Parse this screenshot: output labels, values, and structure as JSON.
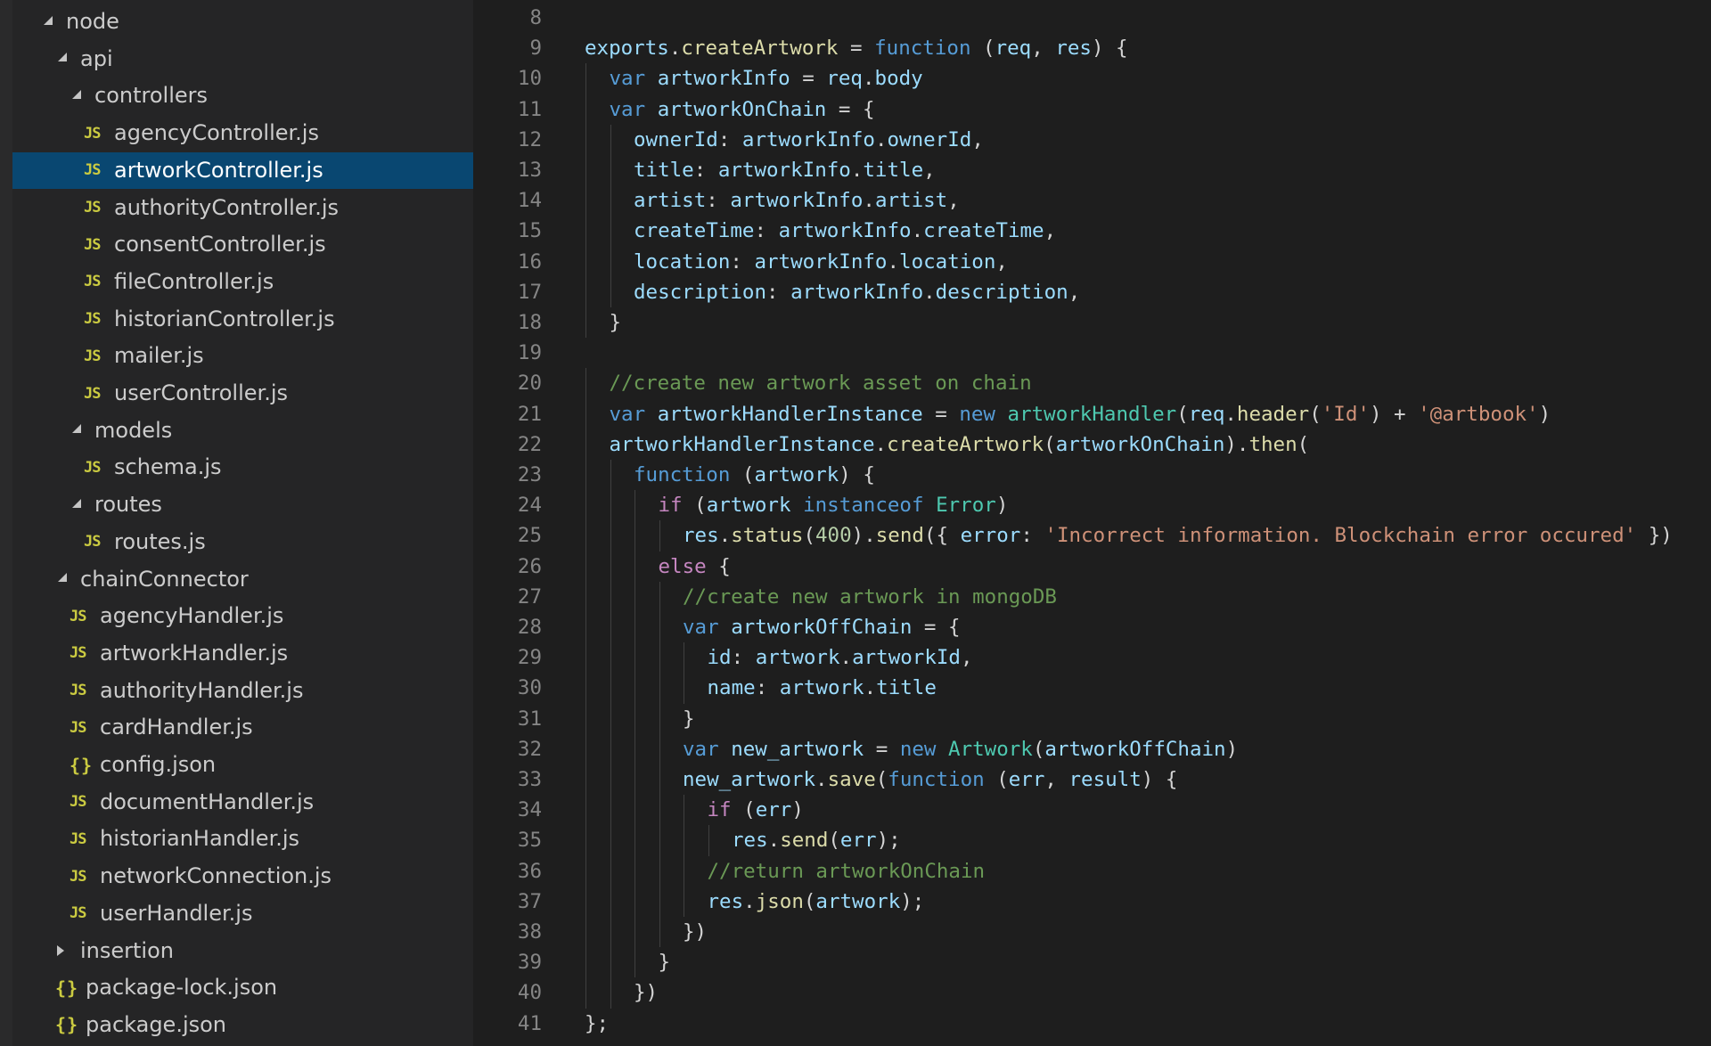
{
  "colors": {
    "sidebar_bg": "#252526",
    "editor_bg": "#1e1e1e",
    "selection": "#094771",
    "js_icon": "#cbcb41",
    "keyword": "#569cd6",
    "control": "#c586c0",
    "variable": "#9cdcfe",
    "function": "#dcdcaa",
    "string": "#ce9178",
    "number": "#b5cea8",
    "comment": "#6a9955",
    "class": "#4ec9b0"
  },
  "explorer": {
    "items": [
      {
        "label": "node",
        "type": "folder",
        "expanded": true,
        "depth": 0
      },
      {
        "label": "api",
        "type": "folder",
        "expanded": true,
        "depth": 1
      },
      {
        "label": "controllers",
        "type": "folder",
        "expanded": true,
        "depth": 2
      },
      {
        "label": "agencyController.js",
        "type": "js",
        "depth": 3
      },
      {
        "label": "artworkController.js",
        "type": "js",
        "depth": 3,
        "selected": true
      },
      {
        "label": "authorityController.js",
        "type": "js",
        "depth": 3
      },
      {
        "label": "consentController.js",
        "type": "js",
        "depth": 3
      },
      {
        "label": "fileController.js",
        "type": "js",
        "depth": 3
      },
      {
        "label": "historianController.js",
        "type": "js",
        "depth": 3
      },
      {
        "label": "mailer.js",
        "type": "js",
        "depth": 3
      },
      {
        "label": "userController.js",
        "type": "js",
        "depth": 3
      },
      {
        "label": "models",
        "type": "folder",
        "expanded": true,
        "depth": 2
      },
      {
        "label": "schema.js",
        "type": "js",
        "depth": 3
      },
      {
        "label": "routes",
        "type": "folder",
        "expanded": true,
        "depth": 2
      },
      {
        "label": "routes.js",
        "type": "js",
        "depth": 3
      },
      {
        "label": "chainConnector",
        "type": "folder",
        "expanded": true,
        "depth": 1
      },
      {
        "label": "agencyHandler.js",
        "type": "js",
        "depth": 2
      },
      {
        "label": "artworkHandler.js",
        "type": "js",
        "depth": 2
      },
      {
        "label": "authorityHandler.js",
        "type": "js",
        "depth": 2
      },
      {
        "label": "cardHandler.js",
        "type": "js",
        "depth": 2
      },
      {
        "label": "config.json",
        "type": "json",
        "depth": 2
      },
      {
        "label": "documentHandler.js",
        "type": "js",
        "depth": 2
      },
      {
        "label": "historianHandler.js",
        "type": "js",
        "depth": 2
      },
      {
        "label": "networkConnection.js",
        "type": "js",
        "depth": 2
      },
      {
        "label": "userHandler.js",
        "type": "js",
        "depth": 2
      },
      {
        "label": "insertion",
        "type": "folder",
        "expanded": false,
        "depth": 1
      },
      {
        "label": "package-lock.json",
        "type": "json",
        "depth": 1
      },
      {
        "label": "package.json",
        "type": "json",
        "depth": 1
      }
    ],
    "icons": {
      "js": "JS",
      "json": "{}"
    }
  },
  "editor": {
    "lines": [
      {
        "n": "8",
        "indent": 0,
        "tokens": []
      },
      {
        "n": "9",
        "indent": 0,
        "tokens": [
          [
            "var",
            "exports"
          ],
          [
            "punc",
            "."
          ],
          [
            "fn",
            "createArtwork"
          ],
          [
            "punc",
            " = "
          ],
          [
            "kw",
            "function"
          ],
          [
            "punc",
            " ("
          ],
          [
            "var",
            "req"
          ],
          [
            "punc",
            ", "
          ],
          [
            "var",
            "res"
          ],
          [
            "punc",
            ") {"
          ]
        ]
      },
      {
        "n": "10",
        "indent": 1,
        "tokens": [
          [
            "kw",
            "var"
          ],
          [
            "punc",
            " "
          ],
          [
            "var",
            "artworkInfo"
          ],
          [
            "punc",
            " = "
          ],
          [
            "var",
            "req"
          ],
          [
            "punc",
            "."
          ],
          [
            "var",
            "body"
          ]
        ]
      },
      {
        "n": "11",
        "indent": 1,
        "tokens": [
          [
            "kw",
            "var"
          ],
          [
            "punc",
            " "
          ],
          [
            "var",
            "artworkOnChain"
          ],
          [
            "punc",
            " = {"
          ]
        ]
      },
      {
        "n": "12",
        "indent": 2,
        "tokens": [
          [
            "var",
            "ownerId"
          ],
          [
            "punc",
            ": "
          ],
          [
            "var",
            "artworkInfo"
          ],
          [
            "punc",
            "."
          ],
          [
            "var",
            "ownerId"
          ],
          [
            "punc",
            ","
          ]
        ]
      },
      {
        "n": "13",
        "indent": 2,
        "tokens": [
          [
            "var",
            "title"
          ],
          [
            "punc",
            ": "
          ],
          [
            "var",
            "artworkInfo"
          ],
          [
            "punc",
            "."
          ],
          [
            "var",
            "title"
          ],
          [
            "punc",
            ","
          ]
        ]
      },
      {
        "n": "14",
        "indent": 2,
        "tokens": [
          [
            "var",
            "artist"
          ],
          [
            "punc",
            ": "
          ],
          [
            "var",
            "artworkInfo"
          ],
          [
            "punc",
            "."
          ],
          [
            "var",
            "artist"
          ],
          [
            "punc",
            ","
          ]
        ]
      },
      {
        "n": "15",
        "indent": 2,
        "tokens": [
          [
            "var",
            "createTime"
          ],
          [
            "punc",
            ": "
          ],
          [
            "var",
            "artworkInfo"
          ],
          [
            "punc",
            "."
          ],
          [
            "var",
            "createTime"
          ],
          [
            "punc",
            ","
          ]
        ]
      },
      {
        "n": "16",
        "indent": 2,
        "tokens": [
          [
            "var",
            "location"
          ],
          [
            "punc",
            ": "
          ],
          [
            "var",
            "artworkInfo"
          ],
          [
            "punc",
            "."
          ],
          [
            "var",
            "location"
          ],
          [
            "punc",
            ","
          ]
        ]
      },
      {
        "n": "17",
        "indent": 2,
        "tokens": [
          [
            "var",
            "description"
          ],
          [
            "punc",
            ": "
          ],
          [
            "var",
            "artworkInfo"
          ],
          [
            "punc",
            "."
          ],
          [
            "var",
            "description"
          ],
          [
            "punc",
            ","
          ]
        ]
      },
      {
        "n": "18",
        "indent": 1,
        "tokens": [
          [
            "punc",
            "}"
          ]
        ]
      },
      {
        "n": "19",
        "indent": 0,
        "tokens": []
      },
      {
        "n": "20",
        "indent": 1,
        "tokens": [
          [
            "com",
            "//create new artwork asset on chain"
          ]
        ]
      },
      {
        "n": "21",
        "indent": 1,
        "tokens": [
          [
            "kw",
            "var"
          ],
          [
            "punc",
            " "
          ],
          [
            "var",
            "artworkHandlerInstance"
          ],
          [
            "punc",
            " = "
          ],
          [
            "kw",
            "new"
          ],
          [
            "punc",
            " "
          ],
          [
            "cls",
            "artworkHandler"
          ],
          [
            "punc",
            "("
          ],
          [
            "var",
            "req"
          ],
          [
            "punc",
            "."
          ],
          [
            "fn",
            "header"
          ],
          [
            "punc",
            "("
          ],
          [
            "str",
            "'Id'"
          ],
          [
            "punc",
            ") + "
          ],
          [
            "str",
            "'@artbook'"
          ],
          [
            "punc",
            ")"
          ]
        ]
      },
      {
        "n": "22",
        "indent": 1,
        "tokens": [
          [
            "var",
            "artworkHandlerInstance"
          ],
          [
            "punc",
            "."
          ],
          [
            "fn",
            "createArtwork"
          ],
          [
            "punc",
            "("
          ],
          [
            "var",
            "artworkOnChain"
          ],
          [
            "punc",
            ")."
          ],
          [
            "fn",
            "then"
          ],
          [
            "punc",
            "("
          ]
        ]
      },
      {
        "n": "23",
        "indent": 2,
        "tokens": [
          [
            "kw",
            "function"
          ],
          [
            "punc",
            " ("
          ],
          [
            "var",
            "artwork"
          ],
          [
            "punc",
            ") {"
          ]
        ]
      },
      {
        "n": "24",
        "indent": 3,
        "tokens": [
          [
            "ctl",
            "if"
          ],
          [
            "punc",
            " ("
          ],
          [
            "var",
            "artwork"
          ],
          [
            "punc",
            " "
          ],
          [
            "kw",
            "instanceof"
          ],
          [
            "punc",
            " "
          ],
          [
            "cls",
            "Error"
          ],
          [
            "punc",
            ")"
          ]
        ]
      },
      {
        "n": "25",
        "indent": 4,
        "tokens": [
          [
            "var",
            "res"
          ],
          [
            "punc",
            "."
          ],
          [
            "fn",
            "status"
          ],
          [
            "punc",
            "("
          ],
          [
            "num",
            "400"
          ],
          [
            "punc",
            ")."
          ],
          [
            "fn",
            "send"
          ],
          [
            "punc",
            "({ "
          ],
          [
            "var",
            "error"
          ],
          [
            "punc",
            ": "
          ],
          [
            "str",
            "'Incorrect information. Blockchain error occured'"
          ],
          [
            "punc",
            " })"
          ]
        ]
      },
      {
        "n": "26",
        "indent": 3,
        "tokens": [
          [
            "ctl",
            "else"
          ],
          [
            "punc",
            " {"
          ]
        ]
      },
      {
        "n": "27",
        "indent": 4,
        "tokens": [
          [
            "com",
            "//create new artwork in mongoDB"
          ]
        ]
      },
      {
        "n": "28",
        "indent": 4,
        "tokens": [
          [
            "kw",
            "var"
          ],
          [
            "punc",
            " "
          ],
          [
            "var",
            "artworkOffChain"
          ],
          [
            "punc",
            " = {"
          ]
        ]
      },
      {
        "n": "29",
        "indent": 5,
        "tokens": [
          [
            "var",
            "id"
          ],
          [
            "punc",
            ": "
          ],
          [
            "var",
            "artwork"
          ],
          [
            "punc",
            "."
          ],
          [
            "var",
            "artworkId"
          ],
          [
            "punc",
            ","
          ]
        ]
      },
      {
        "n": "30",
        "indent": 5,
        "tokens": [
          [
            "var",
            "name"
          ],
          [
            "punc",
            ": "
          ],
          [
            "var",
            "artwork"
          ],
          [
            "punc",
            "."
          ],
          [
            "var",
            "title"
          ]
        ]
      },
      {
        "n": "31",
        "indent": 4,
        "tokens": [
          [
            "punc",
            "}"
          ]
        ]
      },
      {
        "n": "32",
        "indent": 4,
        "tokens": [
          [
            "kw",
            "var"
          ],
          [
            "punc",
            " "
          ],
          [
            "var",
            "new_artwork"
          ],
          [
            "punc",
            " = "
          ],
          [
            "kw",
            "new"
          ],
          [
            "punc",
            " "
          ],
          [
            "cls",
            "Artwork"
          ],
          [
            "punc",
            "("
          ],
          [
            "var",
            "artworkOffChain"
          ],
          [
            "punc",
            ")"
          ]
        ]
      },
      {
        "n": "33",
        "indent": 4,
        "tokens": [
          [
            "var",
            "new_artwork"
          ],
          [
            "punc",
            "."
          ],
          [
            "fn",
            "save"
          ],
          [
            "punc",
            "("
          ],
          [
            "kw",
            "function"
          ],
          [
            "punc",
            " ("
          ],
          [
            "var",
            "err"
          ],
          [
            "punc",
            ", "
          ],
          [
            "var",
            "result"
          ],
          [
            "punc",
            ") {"
          ]
        ]
      },
      {
        "n": "34",
        "indent": 5,
        "tokens": [
          [
            "ctl",
            "if"
          ],
          [
            "punc",
            " ("
          ],
          [
            "var",
            "err"
          ],
          [
            "punc",
            ")"
          ]
        ]
      },
      {
        "n": "35",
        "indent": 6,
        "tokens": [
          [
            "var",
            "res"
          ],
          [
            "punc",
            "."
          ],
          [
            "fn",
            "send"
          ],
          [
            "punc",
            "("
          ],
          [
            "var",
            "err"
          ],
          [
            "punc",
            ");"
          ]
        ]
      },
      {
        "n": "36",
        "indent": 5,
        "tokens": [
          [
            "com",
            "//return artworkOnChain"
          ]
        ]
      },
      {
        "n": "37",
        "indent": 5,
        "tokens": [
          [
            "var",
            "res"
          ],
          [
            "punc",
            "."
          ],
          [
            "fn",
            "json"
          ],
          [
            "punc",
            "("
          ],
          [
            "var",
            "artwork"
          ],
          [
            "punc",
            ");"
          ]
        ]
      },
      {
        "n": "38",
        "indent": 4,
        "tokens": [
          [
            "punc",
            "})"
          ]
        ]
      },
      {
        "n": "39",
        "indent": 3,
        "tokens": [
          [
            "punc",
            "}"
          ]
        ]
      },
      {
        "n": "40",
        "indent": 2,
        "tokens": [
          [
            "punc",
            "})"
          ]
        ]
      },
      {
        "n": "41",
        "indent": 0,
        "tokens": [
          [
            "punc",
            "};"
          ]
        ]
      }
    ]
  }
}
